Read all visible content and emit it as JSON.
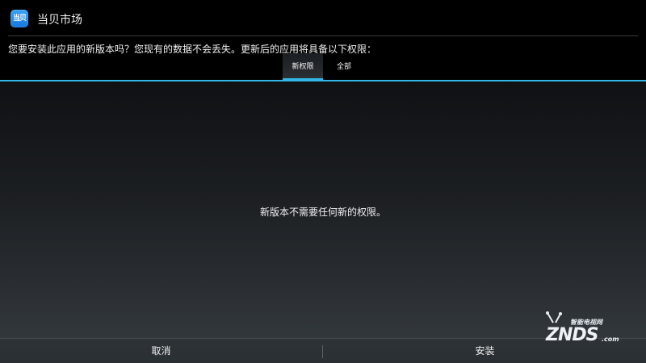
{
  "header": {
    "app_icon_text": "当贝",
    "app_title": "当贝市场"
  },
  "message": "您要安装此应用的新版本吗？您现有的数据不会丢失。更新后的应用将具备以下权限：",
  "tabs": [
    {
      "label": "新权限",
      "selected": true
    },
    {
      "label": "全部",
      "selected": false
    }
  ],
  "content": {
    "empty_text": "新版本不需要任何新的权限。"
  },
  "buttons": {
    "cancel": "取消",
    "install": "安装"
  },
  "watermark": {
    "top_text": "智能电视网",
    "main_text": "ZNDS",
    "suffix": ".com"
  },
  "colors": {
    "accent": "#33b5e5",
    "icon_blue": "#1f8ae8",
    "background": "#000000"
  }
}
